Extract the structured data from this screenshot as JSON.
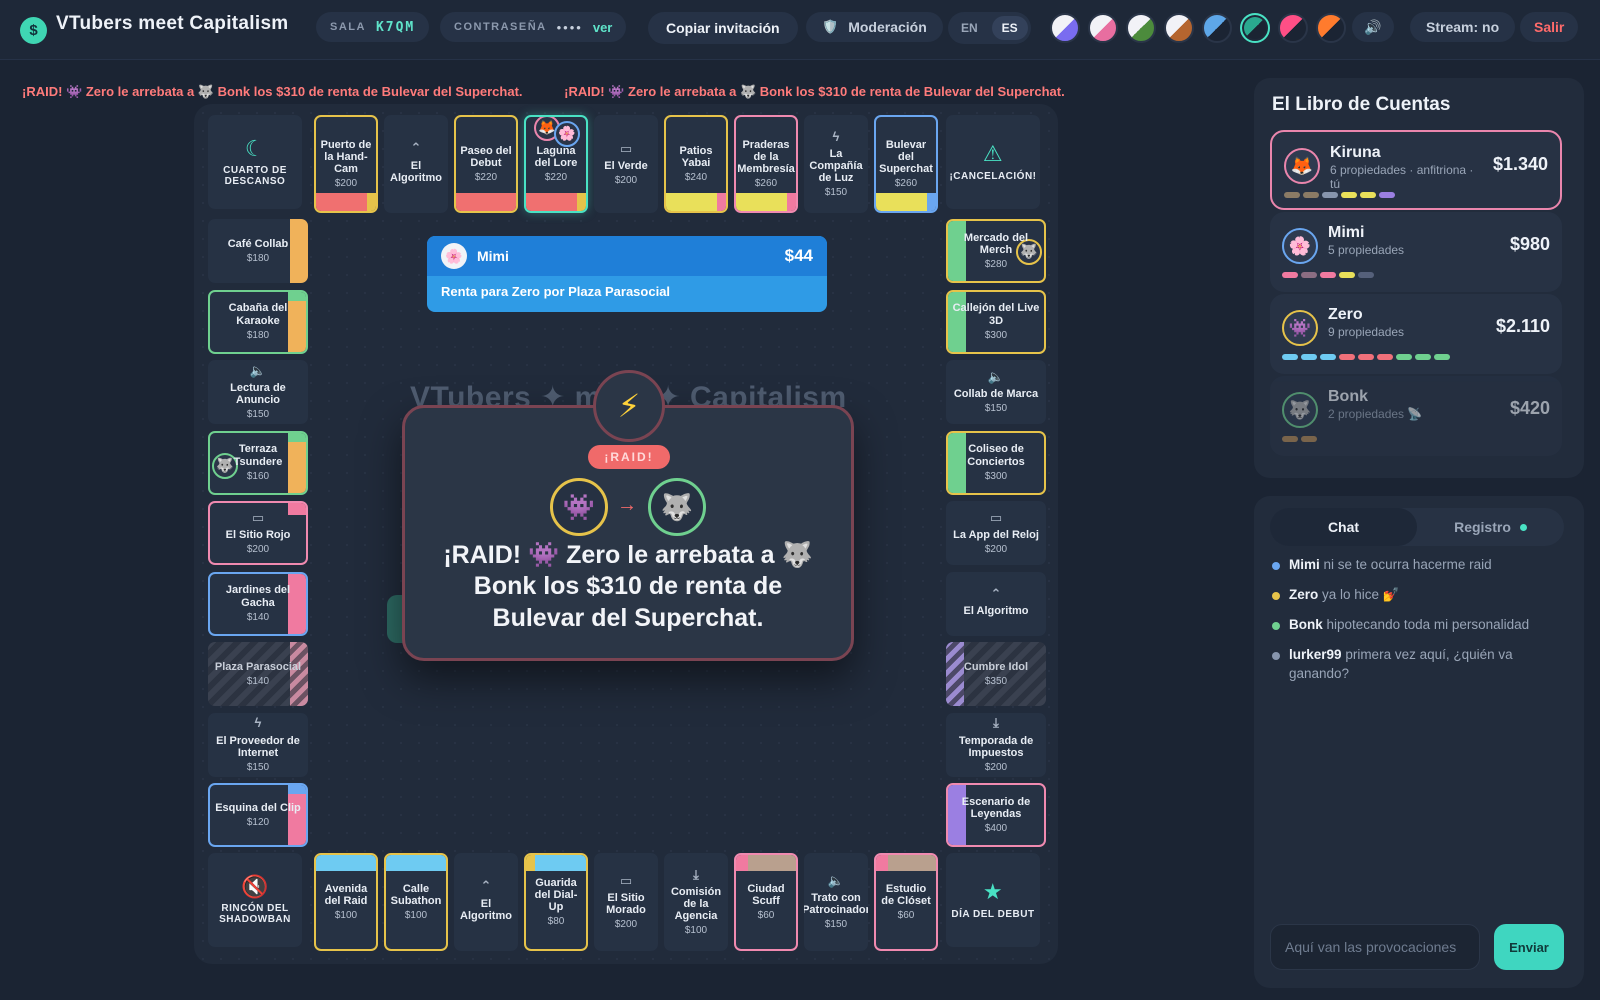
{
  "header": {
    "logo_glyph": "$",
    "title": "VTubers meet Capitalism",
    "room_label": "SALA",
    "room_code": "K7QM",
    "password_label": "CONTRASEÑA",
    "password_mask": "••••",
    "show_label": "ver",
    "invite_label": "Copiar invitación",
    "moderation_label": "Moderación",
    "lang_en": "EN",
    "lang_es": "ES",
    "volume_icon": "🔊",
    "stream_label": "Stream: no",
    "exit_label": "Salir",
    "theme_swatches": [
      {
        "a": "#f2f2f7",
        "b": "#7a6cf0"
      },
      {
        "a": "#f2f2f7",
        "b": "#e86ea0"
      },
      {
        "a": "#f2f2f7",
        "b": "#4c8b3c"
      },
      {
        "a": "#f2f2f7",
        "b": "#b5652f"
      },
      {
        "a": "#5ea7e8",
        "b": "#1b2433"
      },
      {
        "a": "#2aa88f",
        "b": "#1b2433"
      },
      {
        "a": "#ff4f86",
        "b": "#1b2433"
      },
      {
        "a": "#ff7b2d",
        "b": "#1b2433"
      }
    ]
  },
  "ticker": {
    "items": [
      "¡RAID! 👾 Zero le arrebata a 🐺 Bonk los $310 de renta de Bulevar del Superchat.",
      "¡RAID! 👾 Zero le arrebata a 🐺 Bonk los $310 de renta de Bulevar del Superchat."
    ]
  },
  "board": {
    "corners": {
      "top_left": {
        "icon": "☾",
        "label": "CUARTO DE DESCANSO"
      },
      "top_right": {
        "icon": "⚠",
        "label": "¡CANCELACIÓN!"
      },
      "bottom_left": {
        "icon": "🔇",
        "label": "RINCÓN DEL SHADOWBAN"
      },
      "bottom_right": {
        "icon": "★",
        "label": "DÍA DEL DEBUT"
      }
    },
    "top": [
      {
        "name": "Puerto de la Hand-Cam",
        "price": "$200"
      },
      {
        "name": "El Algoritmo",
        "price": ""
      },
      {
        "name": "Paseo del Debut",
        "price": "$220"
      },
      {
        "name": "Laguna del Lore",
        "price": "$220"
      },
      {
        "name": "El Verde",
        "price": "$200"
      },
      {
        "name": "Patios Yabai",
        "price": "$240"
      },
      {
        "name": "Praderas de la Membresía",
        "price": "$260"
      },
      {
        "name": "La Compañía de Luz",
        "price": "$150"
      },
      {
        "name": "Bulevar del Superchat",
        "price": "$260"
      }
    ],
    "left": [
      {
        "name": "Café Collab",
        "price": "$180"
      },
      {
        "name": "Cabaña del Karaoke",
        "price": "$180"
      },
      {
        "name": "Lectura de Anuncio",
        "price": "$150"
      },
      {
        "name": "Terraza Tsundere",
        "price": "$160"
      },
      {
        "name": "El Sitio Rojo",
        "price": "$200"
      },
      {
        "name": "Jardines del Gacha",
        "price": "$140"
      },
      {
        "name": "Plaza Parasocial",
        "price": "$140"
      },
      {
        "name": "El Proveedor de Internet",
        "price": "$150"
      },
      {
        "name": "Esquina del Clip",
        "price": "$120"
      }
    ],
    "right": [
      {
        "name": "Mercado del Merch",
        "price": "$280"
      },
      {
        "name": "Callejón del Live 3D",
        "price": "$300"
      },
      {
        "name": "Collab de Marca",
        "price": "$150"
      },
      {
        "name": "Coliseo de Conciertos",
        "price": "$300"
      },
      {
        "name": "La App del Reloj",
        "price": "$200"
      },
      {
        "name": "El Algoritmo",
        "price": ""
      },
      {
        "name": "Cumbre Idol",
        "price": "$350"
      },
      {
        "name": "Temporada de Impuestos",
        "price": "$200"
      },
      {
        "name": "Escenario de Leyendas",
        "price": "$400"
      }
    ],
    "bottom": [
      {
        "name": "Avenida del Raid",
        "price": "$100"
      },
      {
        "name": "Calle Subathon",
        "price": "$100"
      },
      {
        "name": "El Algoritmo",
        "price": ""
      },
      {
        "name": "Guarida del Dial-Up",
        "price": "$80"
      },
      {
        "name": "El Sitio Morado",
        "price": "$200"
      },
      {
        "name": "Comisión de la Agencia",
        "price": "$100"
      },
      {
        "name": "Ciudad Scuff",
        "price": "$60"
      },
      {
        "name": "Trato con Patrocinador",
        "price": "$150"
      },
      {
        "name": "Estudio de Clóset",
        "price": "$60"
      }
    ],
    "center_title": "VTubers ✦ meet ✦ Capitalism",
    "toast": {
      "avatar": "🌸",
      "name": "Mimi",
      "amount": "$44",
      "message": "Renta para Zero por Plaza Parasocial"
    },
    "raid": {
      "icon": "⚡",
      "badge": "¡RAID!",
      "from_avatar": "👾",
      "arrow": "→",
      "to_avatar": "🐺",
      "text": "¡RAID! 👾 Zero le arrebata a 🐺 Bonk los $310 de renta de Bulevar del Superchat."
    }
  },
  "ledger": {
    "title": "El Libro de Cuentas",
    "players": [
      {
        "avatar": "🦊",
        "name": "Kiruna",
        "sub": "6 propiedades · anfitriona · tú",
        "cash": "$1.340",
        "ring": "#ea86ad",
        "chips": [
          "#8b7b65",
          "#8b7b65",
          "#8795ad",
          "#e9e05a",
          "#e9e05a",
          "#9b7fe2"
        ]
      },
      {
        "avatar": "🌸",
        "name": "Mimi",
        "sub": "5 propiedades",
        "cash": "$980",
        "ring": "#6aa6f0",
        "chips": [
          "#f07aa0",
          "#8b6d82",
          "#f07aa0",
          "#e9e05a",
          "#55607a"
        ]
      },
      {
        "avatar": "👾",
        "name": "Zero",
        "sub": "9 propiedades",
        "cash": "$2.110",
        "ring": "#e6c34a",
        "chips": [
          "#6ecbf2",
          "#6ecbf2",
          "#6ecbf2",
          "#f0707a",
          "#f0707a",
          "#f0707a",
          "#6fd08f",
          "#6fd08f",
          "#6fd08f"
        ]
      },
      {
        "avatar": "🐺",
        "name": "Bonk",
        "sub": "2 propiedades 📡",
        "cash": "$420",
        "ring": "#6fd08f",
        "chips": [
          "#b38a55",
          "#b38a55"
        ]
      }
    ]
  },
  "chat": {
    "tab_chat": "Chat",
    "tab_log": "Registro",
    "messages": [
      {
        "user": "Mimi",
        "text": "ni se te ocurra hacerme raid",
        "color": "#6aa6f0"
      },
      {
        "user": "Zero",
        "text": "ya lo hice 💅",
        "color": "#e6c34a"
      },
      {
        "user": "Bonk",
        "text": "hipotecando toda mi personalidad",
        "color": "#6fd08f"
      },
      {
        "user": "lurker99",
        "text": "primera vez aquí, ¿quién va ganando?",
        "color": "#8795ad"
      }
    ],
    "placeholder": "Aquí van las provocaciones",
    "send_label": "Enviar"
  }
}
